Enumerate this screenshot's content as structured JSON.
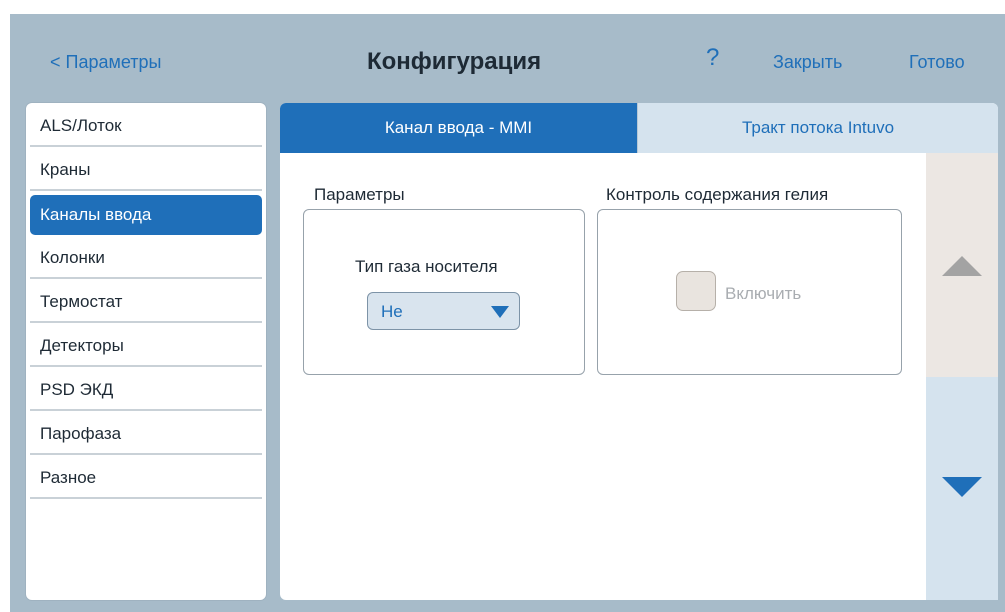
{
  "header": {
    "back_label": "< Параметры",
    "title": "Конфигурация",
    "help_label": "?",
    "close_label": "Закрыть",
    "done_label": "Готово"
  },
  "sidebar": {
    "items": [
      {
        "label": "ALS/Лоток",
        "selected": false
      },
      {
        "label": "Краны",
        "selected": false
      },
      {
        "label": "Каналы ввода",
        "selected": true
      },
      {
        "label": "Колонки",
        "selected": false
      },
      {
        "label": "Термостат",
        "selected": false
      },
      {
        "label": "Детекторы",
        "selected": false
      },
      {
        "label": "PSD ЭКД",
        "selected": false
      },
      {
        "label": "Парофаза",
        "selected": false
      },
      {
        "label": "Разное",
        "selected": false
      }
    ]
  },
  "tabs": [
    {
      "label": "Канал ввода - MMI",
      "active": true
    },
    {
      "label": "Тракт потока Intuvo",
      "active": false
    }
  ],
  "parameters": {
    "title": "Параметры",
    "carrier_gas_label": "Тип газа носителя",
    "carrier_gas_value": "He"
  },
  "helium": {
    "title": "Контроль содержания гелия",
    "enable_label": "Включить",
    "enabled": false
  },
  "colors": {
    "accent": "#1f6fb9",
    "background": "#a7bbc9",
    "inactive_tab": "#d5e3ee",
    "disabled_text": "#a9adb1"
  }
}
